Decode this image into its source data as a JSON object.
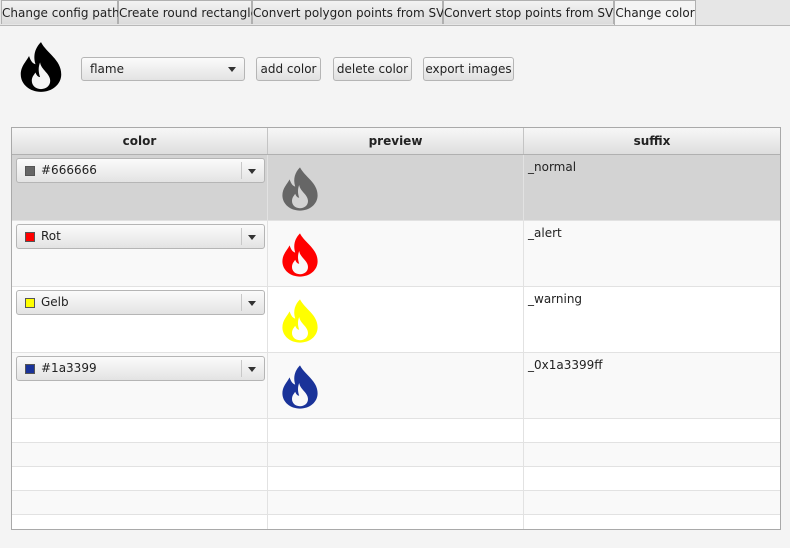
{
  "tabs": [
    {
      "label": "Change config path",
      "active": false
    },
    {
      "label": "Create round rectangle",
      "active": false
    },
    {
      "label": "Convert polygon points from SVG",
      "active": false
    },
    {
      "label": "Convert stop points from SVG",
      "active": false
    },
    {
      "label": "Change color",
      "active": true
    }
  ],
  "toolbar": {
    "icon": "flame-icon",
    "icon_select_value": "flame",
    "add_color_label": "add color",
    "delete_color_label": "delete color",
    "export_images_label": "export images"
  },
  "table": {
    "columns": [
      "color",
      "preview",
      "suffix"
    ],
    "rows": [
      {
        "color_label": "#666666",
        "color_hex": "#666666",
        "suffix": "_normal",
        "selected": true
      },
      {
        "color_label": "Rot",
        "color_hex": "#ff0000",
        "suffix": "_alert",
        "selected": false
      },
      {
        "color_label": "Gelb",
        "color_hex": "#ffff00",
        "suffix": "_warning",
        "selected": false
      },
      {
        "color_label": "#1a3399",
        "color_hex": "#1a3399",
        "suffix": "_0x1a3399ff",
        "selected": false
      }
    ]
  },
  "colors": {
    "selected_row": "#d3d3d3",
    "alt_row": "#f9f9f9"
  }
}
